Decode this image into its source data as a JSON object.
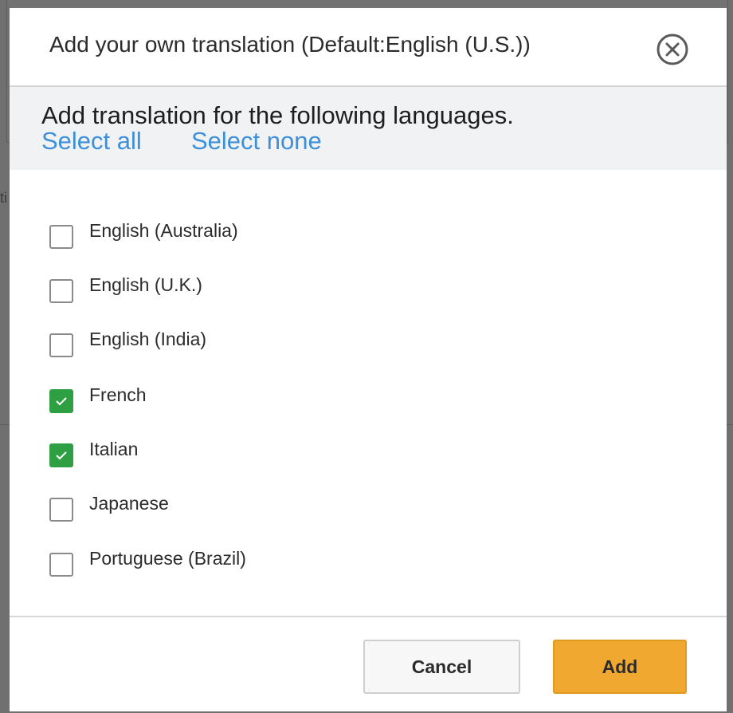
{
  "dialog": {
    "title": "Add your own translation (Default:English (U.S.))",
    "close_icon": "close-circle-icon"
  },
  "intro": {
    "text": "Add translation for the following languages.",
    "select_all": "Select all",
    "select_none": "Select none"
  },
  "languages": [
    {
      "label": "English (Australia)",
      "checked": false
    },
    {
      "label": "English (U.K.)",
      "checked": false
    },
    {
      "label": "English (India)",
      "checked": false
    },
    {
      "label": "French",
      "checked": true
    },
    {
      "label": "Italian",
      "checked": true
    },
    {
      "label": "Japanese",
      "checked": false
    },
    {
      "label": "Portuguese (Brazil)",
      "checked": false
    }
  ],
  "footer": {
    "cancel_label": "Cancel",
    "add_label": "Add"
  },
  "colors": {
    "accent_link": "#3d8fd8",
    "checked": "#2ea043",
    "primary_button": "#f0a830"
  },
  "backdrop": {
    "text": "ti"
  }
}
